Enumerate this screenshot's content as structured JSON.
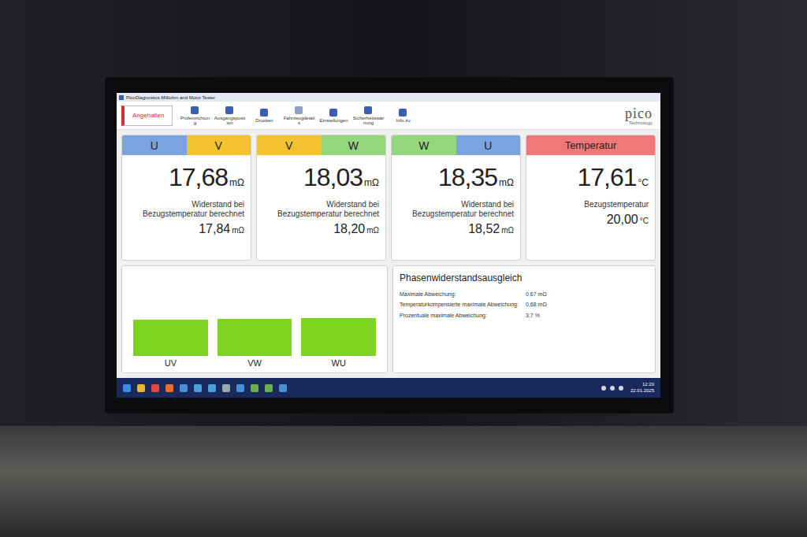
{
  "window": {
    "title": "PicoDiagnostics Milliohm and Motor Tester"
  },
  "toolbar": {
    "status_button": {
      "label": "Angehalten",
      "color": "#d62f2f"
    },
    "items": [
      {
        "label": "Prüfeinrichtung"
      },
      {
        "label": "Ausgangsposition"
      },
      {
        "label": "Drucken"
      },
      {
        "label": "Fahrzeugdetails"
      },
      {
        "label": "Einstellungen"
      },
      {
        "label": "Sicherheitswarnung"
      },
      {
        "label": "Info zu"
      }
    ]
  },
  "logo": {
    "name": "pico",
    "subtitle": "Technology"
  },
  "cards": [
    {
      "phases": [
        {
          "label": "U",
          "color": "#7aa3e0"
        },
        {
          "label": "V",
          "color": "#f2c230"
        }
      ],
      "value": "17,68",
      "unit": "mΩ",
      "caption": "Widerstand bei Bezugstemperatur berechnet",
      "ref_value": "17,84",
      "ref_unit": "mΩ"
    },
    {
      "phases": [
        {
          "label": "V",
          "color": "#f2c230"
        },
        {
          "label": "W",
          "color": "#93d67c"
        }
      ],
      "value": "18,03",
      "unit": "mΩ",
      "caption": "Widerstand bei Bezugstemperatur berechnet",
      "ref_value": "18,20",
      "ref_unit": "mΩ"
    },
    {
      "phases": [
        {
          "label": "W",
          "color": "#93d67c"
        },
        {
          "label": "U",
          "color": "#7aa3e0"
        }
      ],
      "value": "18,35",
      "unit": "mΩ",
      "caption": "Widerstand bei Bezugstemperatur berechnet",
      "ref_value": "18,52",
      "ref_unit": "mΩ"
    }
  ],
  "temperature": {
    "title": "Temperatur",
    "color": "#f07878",
    "value": "17,61",
    "unit": "°C",
    "caption": "Bezugstemperatur",
    "ref_value": "20,00",
    "ref_unit": "°C"
  },
  "chart": {
    "bars": [
      {
        "label": "UV",
        "value": 17.68,
        "color": "#7ed321"
      },
      {
        "label": "VW",
        "value": 18.03,
        "color": "#7ed321"
      },
      {
        "label": "WU",
        "value": 18.35,
        "color": "#7ed321"
      }
    ]
  },
  "balance": {
    "title": "Phasenwiderstandsausgleich",
    "rows": [
      {
        "label": "Maximale Abweichung:",
        "value": "0,67 mΩ"
      },
      {
        "label": "Temperaturkompensierte maximale Abweichung:",
        "value": "0,68 mΩ"
      },
      {
        "label": "Prozentuale maximale Abweichung:",
        "value": "3,7 %"
      }
    ]
  },
  "taskbar": {
    "time": "12:20",
    "date": "22.01.2025"
  }
}
